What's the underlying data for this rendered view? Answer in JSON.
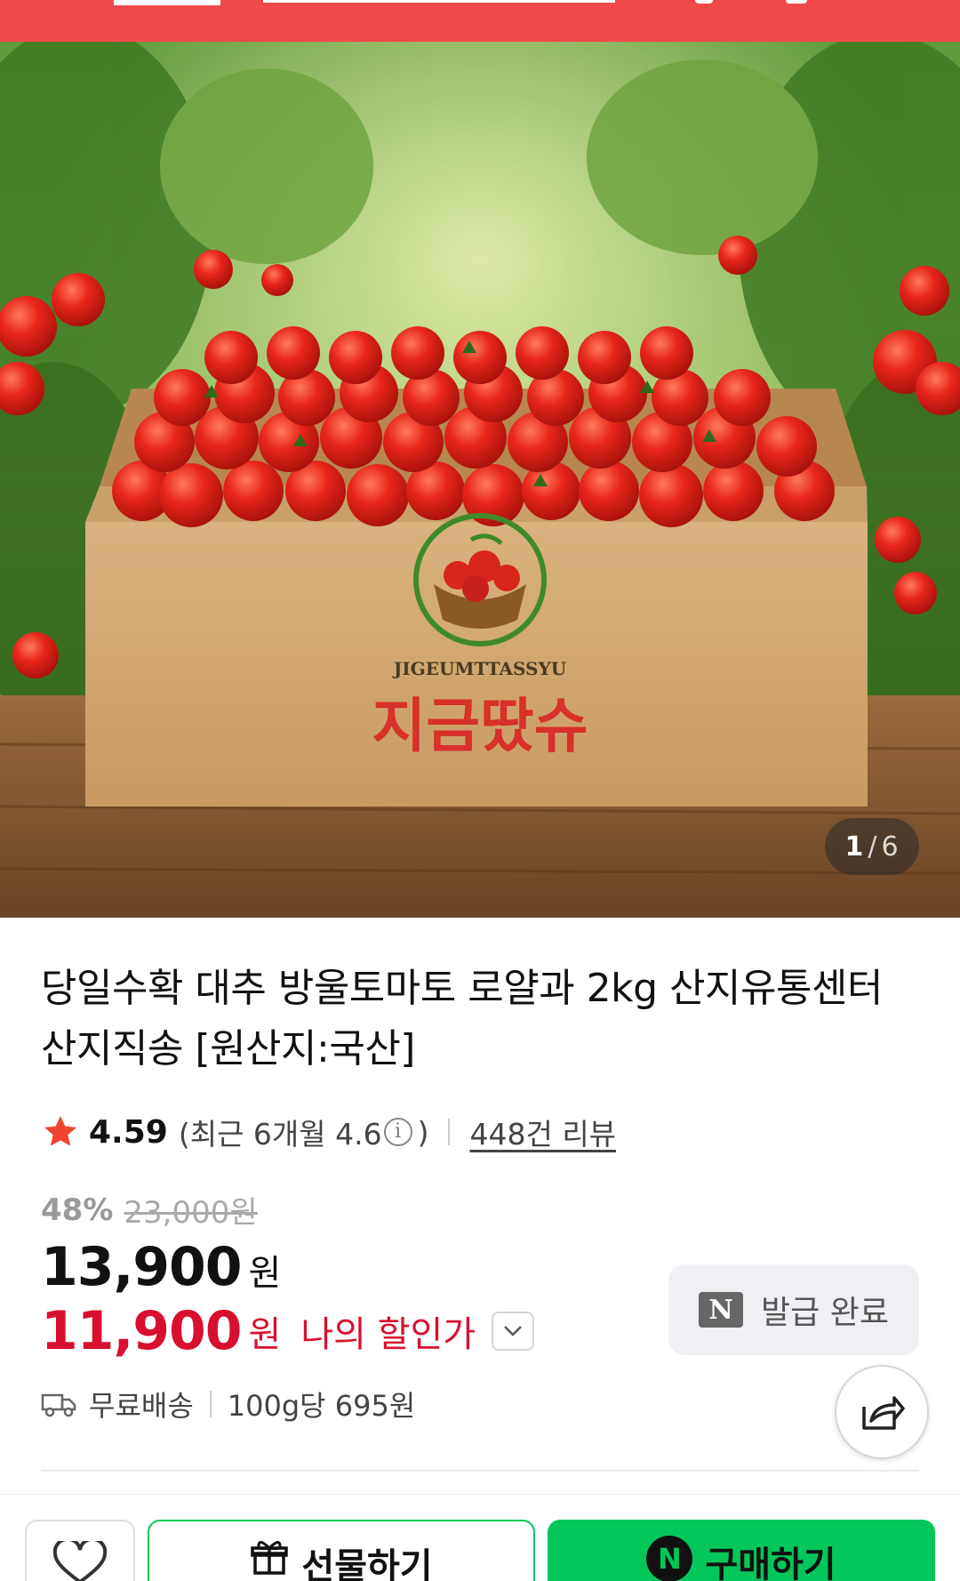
{
  "header": {
    "background_color": "#ef4a49"
  },
  "hero": {
    "box_brand_roman": "JIGEUMTTASSYU",
    "box_brand_korean": "지금땄슈",
    "image_index_current": "1",
    "image_index_separator": "/",
    "image_index_total": "6"
  },
  "product": {
    "title_line1": "당일수확 대추 방울토마토 로얄과 2kg 산지유통센터",
    "title_line2": "산지직송 [원산지:국산]",
    "rating": "4.59",
    "recent_prefix": "(최근 6개월 4.6",
    "recent_suffix": ")",
    "info_icon_glyph": "i",
    "review_count": "448건 리뷰",
    "discount_rate": "48%",
    "original_price": "23,000원",
    "sale_price": "13,900",
    "sale_unit": "원",
    "my_price": "11,900",
    "my_unit": "원",
    "my_price_label": "나의 할인가",
    "coupon_badge": "N",
    "coupon_label": "발급 완료",
    "shipping_label": "무료배송",
    "unit_price": "100g당 695원"
  },
  "bottom_bar": {
    "gift_label": "선물하기",
    "buy_badge": "N",
    "buy_label": "구매하기"
  },
  "colors": {
    "accent_red": "#d8102e",
    "npay_green": "#03c75a",
    "star": "#f0442f"
  },
  "icons": [
    "star-icon",
    "info-icon",
    "chevron-down-icon",
    "truck-icon",
    "share-icon",
    "heart-icon",
    "gift-icon"
  ]
}
